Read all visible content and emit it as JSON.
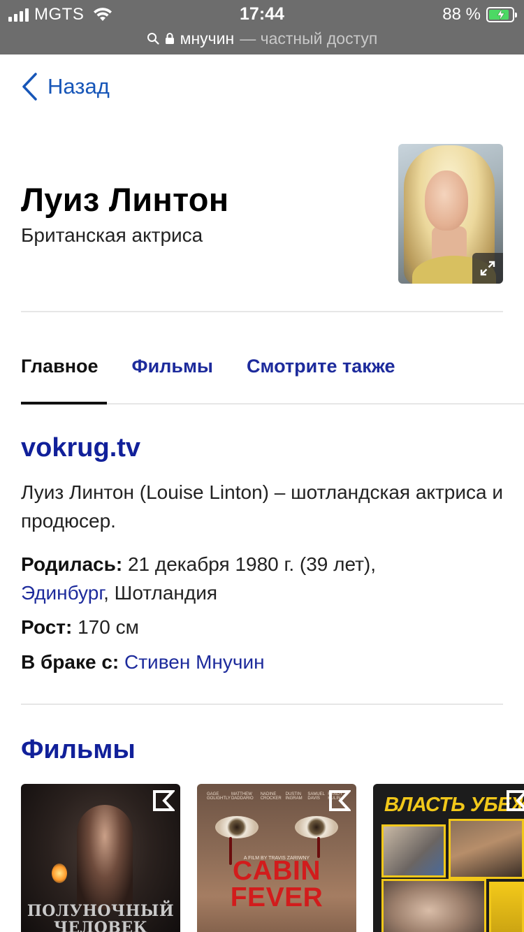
{
  "status_bar": {
    "carrier": "MGTS",
    "time": "17:44",
    "battery_percent": "88 %",
    "battery_level": 0.88,
    "url_domain": "мнучин",
    "url_suffix": "— частный доступ"
  },
  "nav": {
    "back_label": "Назад"
  },
  "person": {
    "name": "Луиз Линтон",
    "description": "Британская актриса"
  },
  "tabs": [
    {
      "label": "Главное",
      "active": true
    },
    {
      "label": "Фильмы",
      "active": false
    },
    {
      "label": "Смотрите также",
      "active": false
    }
  ],
  "info": {
    "source": "vokrug.tv",
    "summary": "Луиз Линтон (Louise Linton) – шотландская актриса и продюсер.",
    "born_label": "Родилась:",
    "born_value": "21 декабря 1980 г. (39 лет),",
    "born_city": "Эдинбург",
    "born_country": ", Шотландия",
    "height_label": "Рост:",
    "height_value": "170 см",
    "spouse_label": "В браке с:",
    "spouse_value": "Стивен Мнучин"
  },
  "films": {
    "section_title": "Фильмы",
    "items": [
      {
        "poster_title": "ПОЛУНОЧНЫЙ ЧЕЛОВЕК"
      },
      {
        "poster_title": "CABIN FEVER",
        "poster_tagline": "A FILM BY TRAVIS ZARIWNY",
        "poster_cast": [
          "GAGE GOLIGHTLY",
          "MATTHEW DADDARIO",
          "NADINE CROCKER",
          "DUSTIN INGRAM",
          "SAMUEL DAVIS",
          "RANDY HULIN"
        ]
      },
      {
        "poster_title": "ВЛАСТЬ УБЕЖДЕНИЯ"
      }
    ]
  },
  "colors": {
    "link_blue": "#1d2b9c",
    "heading_blue": "#11209a",
    "back_blue": "#1756b8",
    "status_bar_bg": "#6d6d6d",
    "battery_green": "#4cd964"
  },
  "icons": [
    "signal-icon",
    "wifi-icon",
    "battery-icon",
    "search-icon",
    "lock-icon",
    "chevron-left-icon",
    "expand-icon",
    "kinopoisk-icon"
  ]
}
